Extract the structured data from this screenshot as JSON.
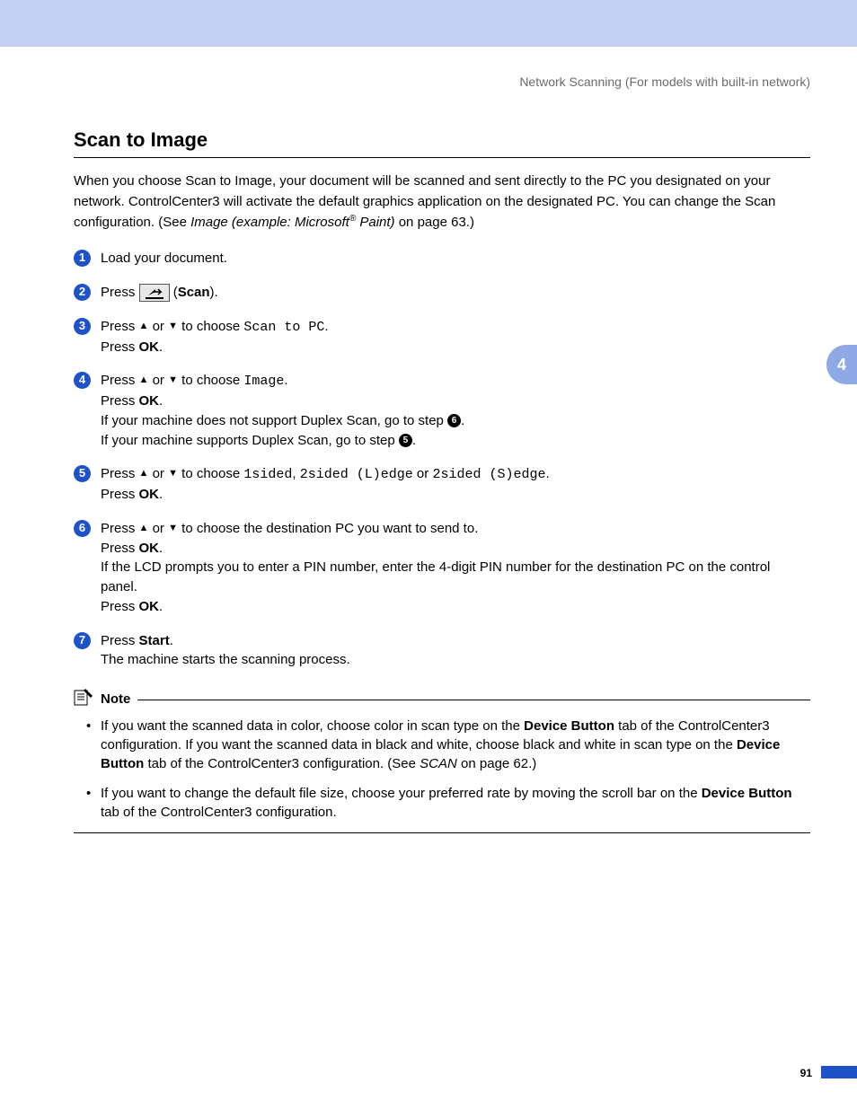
{
  "header": "Network Scanning (For models with built-in network)",
  "chapter_tab": "4",
  "page_number": "91",
  "title": "Scan to Image",
  "intro": {
    "p1": "When you choose Scan to Image, your document will be scanned and sent directly to the PC you designated on your network. ControlCenter3 will activate the default graphics application on the designated PC. You can change the Scan configuration. (See ",
    "link_italic_pre": "Image (example: Microsoft",
    "reg": "®",
    "link_italic_post": " Paint)",
    "p2": " on page 63.)"
  },
  "steps": {
    "s1": {
      "num": "1",
      "text": "Load your document."
    },
    "s2": {
      "num": "2",
      "press": "Press ",
      "paren_open": " (",
      "scan": "Scan",
      "paren_close": ")."
    },
    "s3": {
      "num": "3",
      "press": "Press ",
      "or": " or ",
      "choose": " to choose ",
      "option": "Scan to PC",
      "end": ".",
      "line2a": "Press ",
      "ok": "OK",
      "line2b": "."
    },
    "s4": {
      "num": "4",
      "press": "Press ",
      "or": " or ",
      "choose": " to choose ",
      "option": "Image",
      "end": ".",
      "line2a": "Press ",
      "ok": "OK",
      "line2b": ".",
      "line3": "If your machine does not support Duplex Scan, go to step ",
      "ref3": "6",
      "line3end": ".",
      "line4": "If your machine supports Duplex Scan, go to step ",
      "ref4": "5",
      "line4end": "."
    },
    "s5": {
      "num": "5",
      "press": "Press ",
      "or": " or ",
      "choose": " to choose ",
      "opt1": "1sided",
      "sep1": ", ",
      "opt2": "2sided (L)edge",
      "sep2": " or ",
      "opt3": "2sided (S)edge",
      "end": ".",
      "line2a": "Press ",
      "ok": "OK",
      "line2b": "."
    },
    "s6": {
      "num": "6",
      "press": "Press ",
      "or": " or ",
      "choose": " to choose the destination PC you want to send to.",
      "line2a": "Press ",
      "ok": "OK",
      "line2b": ".",
      "line3": "If the LCD prompts you to enter a PIN number, enter the 4-digit PIN number for the destination PC on the control panel.",
      "line4a": "Press ",
      "ok4": "OK",
      "line4b": "."
    },
    "s7": {
      "num": "7",
      "press": "Press ",
      "start": "Start",
      "end": ".",
      "line2": "The machine starts the scanning process."
    }
  },
  "note": {
    "title": "Note",
    "item1": {
      "a": "If you want the scanned data in color, choose color in scan type on the ",
      "b": "Device Button",
      "c": " tab of the ControlCenter3 configuration. If you want the scanned data in black and white, choose black and white in scan type on the ",
      "d": "Device Button",
      "e": " tab of the ControlCenter3 configuration. (See ",
      "f": "SCAN",
      "g": " on page 62.)"
    },
    "item2": {
      "a": "If you want to change the default file size, choose your preferred rate by moving the scroll bar on the ",
      "b": "Device Button",
      "c": " tab of the ControlCenter3 configuration."
    }
  }
}
